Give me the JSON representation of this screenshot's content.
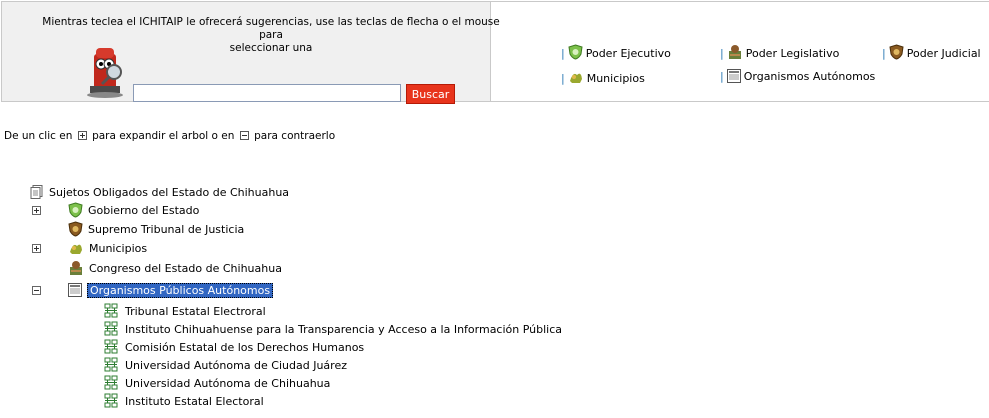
{
  "search": {
    "hint_line1": "Mientras teclea el ICHITAIP le ofrecerá sugerencias, use las teclas de flecha o el mouse para",
    "hint_line2": "seleccionar una",
    "input_value": "",
    "button_label": "Buscar"
  },
  "quick_links": {
    "ejecutivo": "Poder Ejecutivo",
    "legislativo": "Poder Legislativo",
    "judicial": "Poder Judicial",
    "municipios": "Municipios",
    "autonomos": "Organismos Autónomos",
    "separator": "|"
  },
  "instructions": {
    "part1": "De un clic en",
    "part2": "para expandir el arbol o en",
    "part3": "para contraerlo"
  },
  "tree": {
    "root": "Sujetos Obligados del Estado de Chihuahua",
    "nodes": [
      {
        "label": "Gobierno del Estado",
        "icon": "shield-green-icon",
        "expander": "plus"
      },
      {
        "label": "Supremo Tribunal de Justicia",
        "icon": "shield-brown-icon",
        "expander": "none"
      },
      {
        "label": "Municipios",
        "icon": "municipio-icon",
        "expander": "plus"
      },
      {
        "label": "Congreso del Estado de Chihuahua",
        "icon": "congreso-icon",
        "expander": "none"
      },
      {
        "label": "Organismos Públicos Autónomos",
        "icon": "window-icon",
        "expander": "minus",
        "selected": true
      }
    ],
    "children": [
      "Tribunal Estatal Electroral",
      "Instituto Chihuahuense para la Transparencia y Acceso a la Información Pública",
      "Comisión Estatal de los Derechos Humanos",
      "Universidad Autónoma de Ciudad Juárez",
      "Universidad Autónoma de Chihuahua",
      "Instituto Estatal Electoral"
    ]
  },
  "colors": {
    "button": "#e8341c",
    "selection": "#3166c2",
    "separator": "#2c7ab5"
  }
}
